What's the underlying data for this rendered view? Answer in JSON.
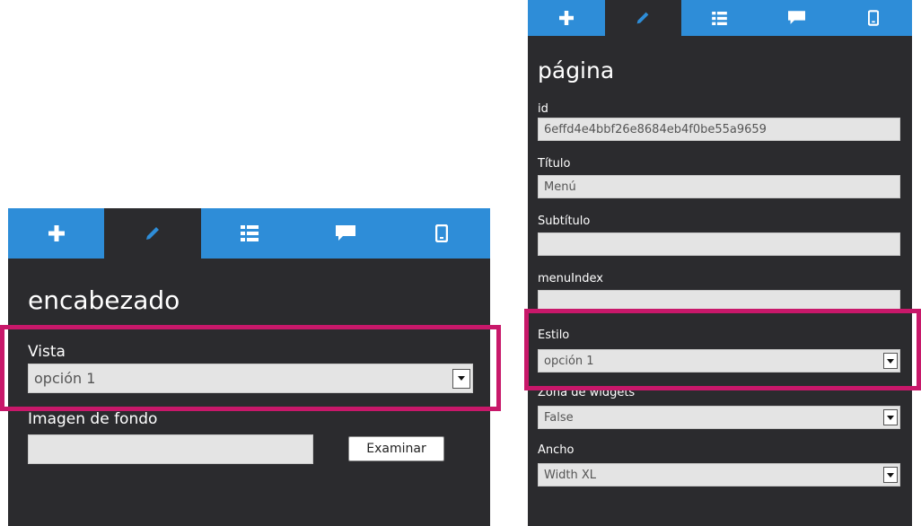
{
  "left_panel": {
    "tabs": [
      {
        "icon": "plus-icon",
        "active": false
      },
      {
        "icon": "pencil-icon",
        "active": true
      },
      {
        "icon": "list-icon",
        "active": false
      },
      {
        "icon": "comment-icon",
        "active": false
      },
      {
        "icon": "mobile-icon",
        "active": false
      }
    ],
    "title": "encabezado",
    "vista_label": "Vista",
    "vista_value": "opción 1",
    "imagen_label": "Imagen de fondo",
    "imagen_value": "",
    "browse_button": "Examinar"
  },
  "right_panel": {
    "title": "página",
    "id_label": "id",
    "id_value": "6effd4e4bbf26e8684eb4f0be55a9659",
    "titulo_label": "Título",
    "titulo_value": "Menú",
    "subtitulo_label": "Subtítulo",
    "subtitulo_value": "",
    "menuindex_label": "menuIndex",
    "menuindex_value": "",
    "estilo_label": "Estilo",
    "estilo_value": "opción 1",
    "zona_label": "Zona de widgets",
    "zona_value": "False",
    "ancho_label": "Ancho",
    "ancho_value": "Width XL"
  },
  "colors": {
    "panel_bg": "#2b2b2e",
    "tab_blue": "#2e8dd8",
    "highlight": "#c8186a",
    "field_bg": "#e4e4e4"
  }
}
